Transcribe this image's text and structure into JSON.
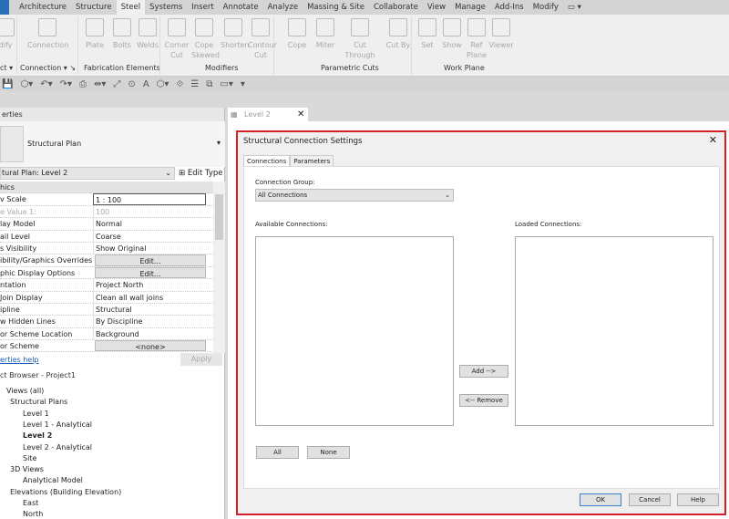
{
  "menu": {
    "tabs": [
      "Architecture",
      "Structure",
      "Steel",
      "Systems",
      "Insert",
      "Annotate",
      "Analyze",
      "Massing & Site",
      "Collaborate",
      "View",
      "Manage",
      "Add-Ins",
      "Modify"
    ],
    "active": "Steel"
  },
  "ribbon": {
    "buttons": [
      {
        "label": "dify"
      },
      {
        "label": "Connection"
      },
      {
        "label": "Plate"
      },
      {
        "label": "Bolts"
      },
      {
        "label": "Welds"
      },
      {
        "label": "Corner Cut"
      },
      {
        "label": "Cope Skewed"
      },
      {
        "label": "Shorten"
      },
      {
        "label": "Contour Cut"
      },
      {
        "label": "Cope"
      },
      {
        "label": "Miter"
      },
      {
        "label": "Cut Through"
      },
      {
        "label": "Cut By"
      },
      {
        "label": "Set"
      },
      {
        "label": "Show"
      },
      {
        "label": "Ref Plane"
      },
      {
        "label": "Viewer"
      }
    ],
    "panels": [
      "ct ▾",
      "Connection ▾ ↘",
      "Fabrication Elements",
      "Modifiers",
      "Parametric Cuts",
      "Work Plane"
    ]
  },
  "properties": {
    "title": "erties",
    "type_name": "Structural Plan",
    "type_selector": "tural Plan: Level 2",
    "edit_type": "Edit Type",
    "rows": [
      {
        "k": "hics",
        "v": "",
        "cat": true
      },
      {
        "k": "v Scale",
        "v": "1 : 100"
      },
      {
        "k": "e Value    1:",
        "v": "100"
      },
      {
        "k": "lay Model",
        "v": "Normal"
      },
      {
        "k": "ail Level",
        "v": "Coarse"
      },
      {
        "k": "s Visibility",
        "v": "Show Original"
      },
      {
        "k": "ibility/Graphics Overrides",
        "v": "Edit...",
        "btn": true
      },
      {
        "k": "phic Display Options",
        "v": "Edit...",
        "btn": true
      },
      {
        "k": "ntation",
        "v": "Project North"
      },
      {
        "k": " Join Display",
        "v": "Clean all wall joins"
      },
      {
        "k": "ipline",
        "v": "Structural"
      },
      {
        "k": "w Hidden Lines",
        "v": "By Discipline"
      },
      {
        "k": "or Scheme Location",
        "v": "Background"
      },
      {
        "k": "or Scheme",
        "v": "<none>",
        "btn": true
      }
    ],
    "help": "erties help",
    "apply": "Apply"
  },
  "browser": {
    "title": "ct Browser - Project1",
    "items": [
      {
        "t": "Views (all)",
        "lvl": 0
      },
      {
        "t": "Structural Plans",
        "lvl": 1
      },
      {
        "t": "Level 1",
        "lvl": 2
      },
      {
        "t": "Level 1 - Analytical",
        "lvl": 2
      },
      {
        "t": "Level 2",
        "lvl": 2,
        "bold": true
      },
      {
        "t": "Level 2 - Analytical",
        "lvl": 2
      },
      {
        "t": "Site",
        "lvl": 2
      },
      {
        "t": "3D Views",
        "lvl": 1
      },
      {
        "t": "Analytical Model",
        "lvl": 2
      },
      {
        "t": "Elevations (Building Elevation)",
        "lvl": 1
      },
      {
        "t": "East",
        "lvl": 2
      },
      {
        "t": "North",
        "lvl": 2
      }
    ]
  },
  "view_tab": {
    "label": "Level 2",
    "close": "✕"
  },
  "dialog": {
    "title": "Structural Connection Settings",
    "close": "✕",
    "tabs": [
      "Connections",
      "Parameters"
    ],
    "group_label": "Connection Group:",
    "group_value": "All Connections",
    "available_label": "Available Connections:",
    "loaded_label": "Loaded Connections:",
    "add": "Add -->",
    "remove": "<-- Remove",
    "all": "All",
    "none": "None",
    "ok": "OK",
    "cancel": "Cancel",
    "help": "Help"
  }
}
